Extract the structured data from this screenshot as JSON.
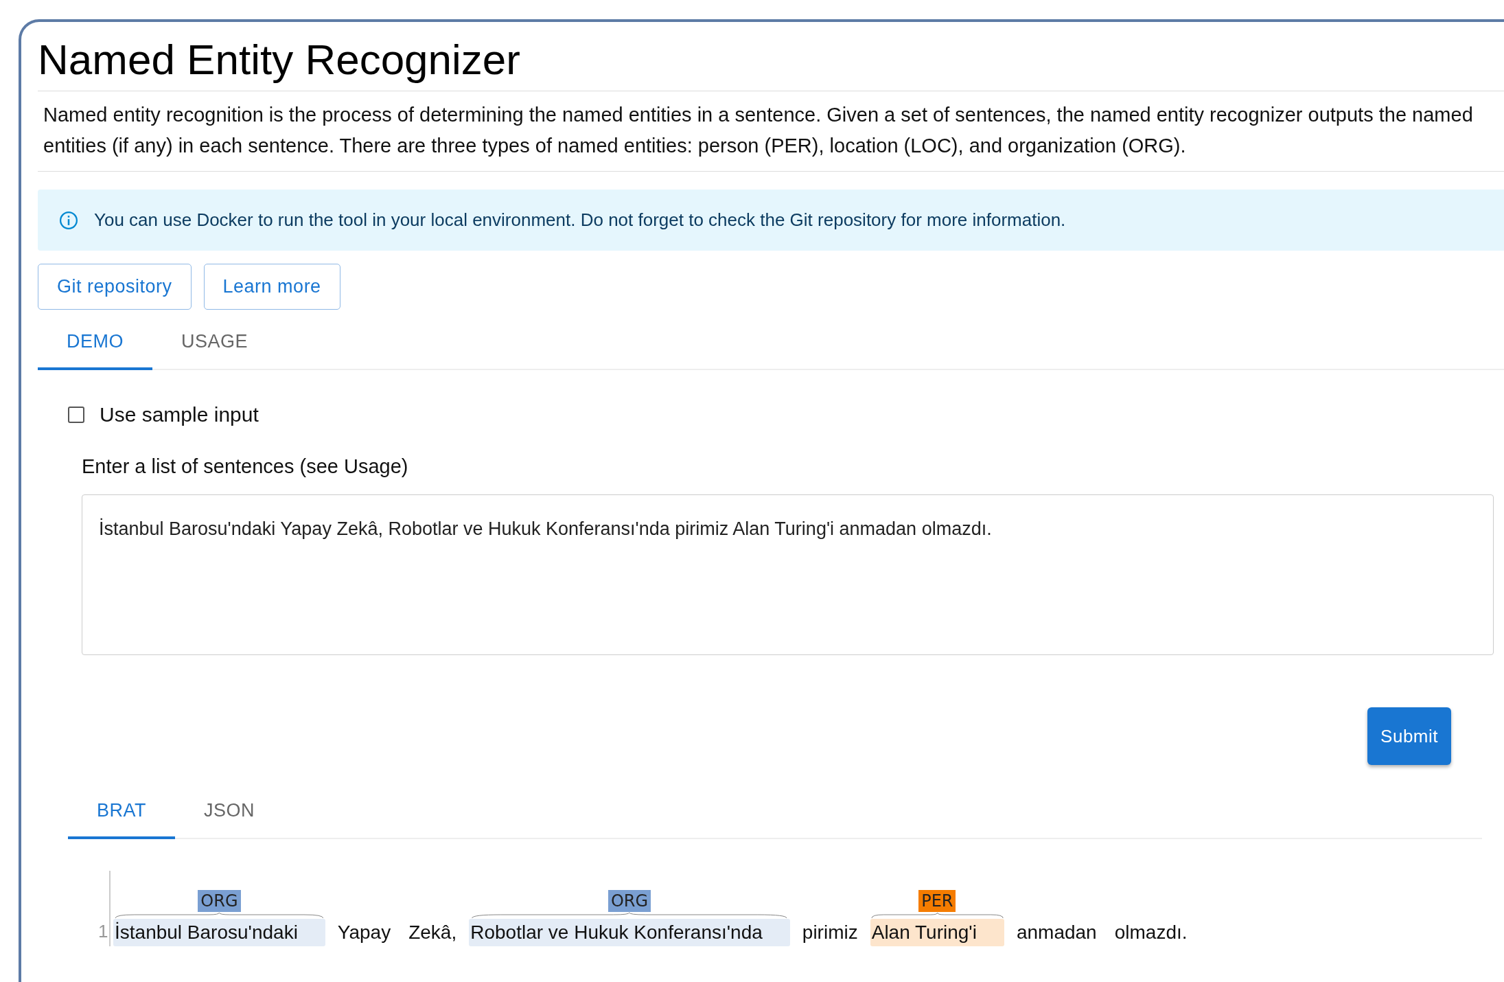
{
  "title": "Named Entity Recognizer",
  "description": "Named entity recognition is the process of determining the named entities in a sentence. Given a set of sentences, the named entity recognizer outputs the named entities (if any) in each sentence. There are three types of named entities: person (PER), location (LOC), and organization (ORG).",
  "alert": {
    "text": "You can use Docker to run the tool in your local environment. Do not forget to check the Git repository for more information."
  },
  "buttons": [
    "Git repository",
    "Learn more"
  ],
  "tabs": [
    {
      "label": "DEMO",
      "selected": true
    },
    {
      "label": "USAGE",
      "selected": false
    }
  ],
  "demo": {
    "sample_checkbox": {
      "label": "Use sample input",
      "checked": false
    },
    "input_label": "Enter a list of sentences (see Usage)",
    "input_value": "İstanbul Barosu'ndaki Yapay Zekâ, Robotlar ve Hukuk Konferansı'nda pirimiz Alan Turing'i anmadan olmazdı.",
    "submit": "Submit"
  },
  "output_tabs": [
    {
      "label": "BRAT",
      "selected": true
    },
    {
      "label": "JSON",
      "selected": false
    }
  ],
  "brat": {
    "line_number": "1",
    "tokens": [
      {
        "kind": "entity",
        "text": "İstanbul Barosu'ndaki",
        "label": "ORG",
        "color": "#7a9fd2"
      },
      {
        "kind": "word",
        "text": "Yapay"
      },
      {
        "kind": "word",
        "text": "Zekâ,"
      },
      {
        "kind": "entity",
        "text": "Robotlar ve Hukuk Konferansı'nda",
        "label": "ORG",
        "color": "#7a9fd2"
      },
      {
        "kind": "word",
        "text": "pirimiz"
      },
      {
        "kind": "entity",
        "text": "Alan Turing'i",
        "label": "PER",
        "color": "#f57c00"
      },
      {
        "kind": "word",
        "text": "anmadan"
      },
      {
        "kind": "word",
        "text": "olmazdı."
      }
    ]
  }
}
